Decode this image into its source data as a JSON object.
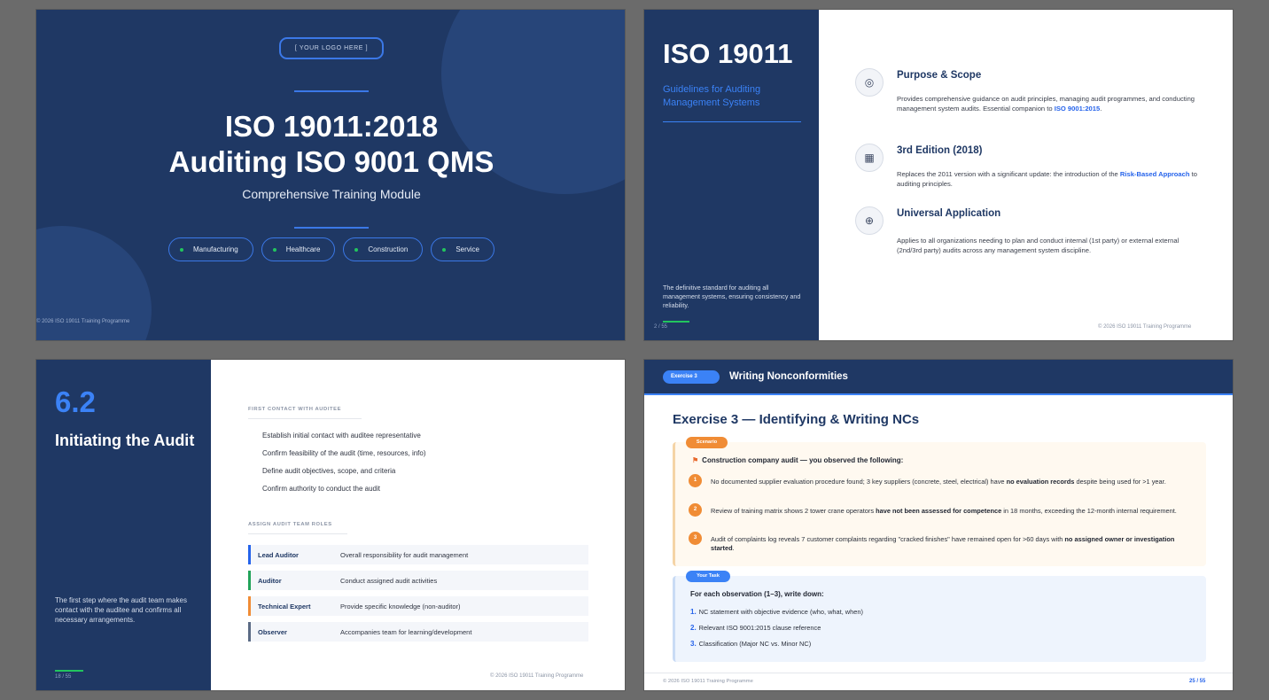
{
  "slide1": {
    "logo": "[ YOUR LOGO HERE ]",
    "title_line1": "ISO 19011:2018",
    "title_line2": "Auditing ISO 9001 QMS",
    "subtitle": "Comprehensive Training Module",
    "tags": [
      "Manufacturing",
      "Healthcare",
      "Construction",
      "Service"
    ],
    "footer": "© 2026 ISO 19011 Training Programme"
  },
  "slide2": {
    "title": "ISO 19011",
    "subtitle": "Guidelines for Auditing Management Systems",
    "description": "The definitive standard for auditing all management systems, ensuring consistency and reliability.",
    "page": "2 / 55",
    "footer": "© 2026 ISO 19011 Training Programme",
    "items": [
      {
        "icon": "target-icon",
        "title": "Purpose & Scope",
        "text": " Provides comprehensive guidance on audit principles, managing audit programmes, and conducting management system audits. Essential companion to ",
        "link": "ISO 9001:2015",
        "after": "."
      },
      {
        "icon": "calendar-icon",
        "title": "3rd Edition (2018)",
        "text": " Replaces the 2011 version with a significant update: the introduction of the ",
        "link": "Risk-Based Approach",
        "after": " to auditing principles."
      },
      {
        "icon": "globe-icon",
        "title": "Universal Application",
        "text": "Applies to all organizations needing to plan and conduct internal (1st party) or external external (2nd/3rd party) audits across any management system discipline.",
        "link": "",
        "after": ""
      }
    ]
  },
  "slide3": {
    "number": "6.2",
    "title": "Initiating the Audit",
    "description": "The first step where the audit team makes contact with the auditee and confirms all necessary arrangements.",
    "page": "18 / 55",
    "footer": "© 2026 ISO 19011 Training Programme",
    "section1": "FIRST CONTACT WITH AUDITEE",
    "tasks": [
      "Establish initial contact with auditee representative",
      "Confirm feasibility of the audit (time, resources, info)",
      "Define audit objectives, scope, and criteria",
      "Confirm authority to conduct the audit"
    ],
    "section2": "ASSIGN AUDIT TEAM ROLES",
    "roles": [
      {
        "name": "Lead Auditor",
        "desc": "Overall responsibility for audit management",
        "color": "#2563eb"
      },
      {
        "name": "Auditor",
        "desc": "Conduct assigned audit activities",
        "color": "#22a35a"
      },
      {
        "name": "Technical Expert",
        "desc": "Provide specific knowledge (non-auditor)",
        "color": "#f08c35"
      },
      {
        "name": "Observer",
        "desc": "Accompanies team for learning/development",
        "color": "#5b6b85"
      }
    ]
  },
  "slide4": {
    "badge": "Exercise 3",
    "header_title": "Writing Nonconformities",
    "title": "Exercise 3 — Identifying & Writing NCs",
    "scenario_tag": "Scenario",
    "scenario_head": "Construction company audit — you observed the following:",
    "observations": [
      {
        "n": "1",
        "pre": "No documented supplier evaluation procedure found; 3 key suppliers (concrete, steel, electrical) have ",
        "bold": "no evaluation records",
        "post": " despite being used for >1 year."
      },
      {
        "n": "2",
        "pre": "Review of training matrix shows 2 tower crane operators ",
        "bold": "have not been assessed for competence",
        "post": " in 18 months, exceeding the 12-month internal requirement."
      },
      {
        "n": "3",
        "pre": "Audit of complaints log reveals 7 customer complaints regarding \"cracked finishes\" have remained open for >60 days with ",
        "bold": "no assigned owner or investigation started",
        "post": "."
      }
    ],
    "task_tag": "Your Task",
    "task_head": "For each observation (1–3), write down:",
    "steps": [
      {
        "n": "1.",
        "text": "NC statement with objective evidence (who, what, when)"
      },
      {
        "n": "2.",
        "text": "Relevant ISO 9001:2015 clause reference"
      },
      {
        "n": "3.",
        "text": "Classification (Major NC vs. Minor NC)"
      }
    ],
    "footer": "© 2026 ISO 19011 Training Programme",
    "page": "25 / 55"
  }
}
